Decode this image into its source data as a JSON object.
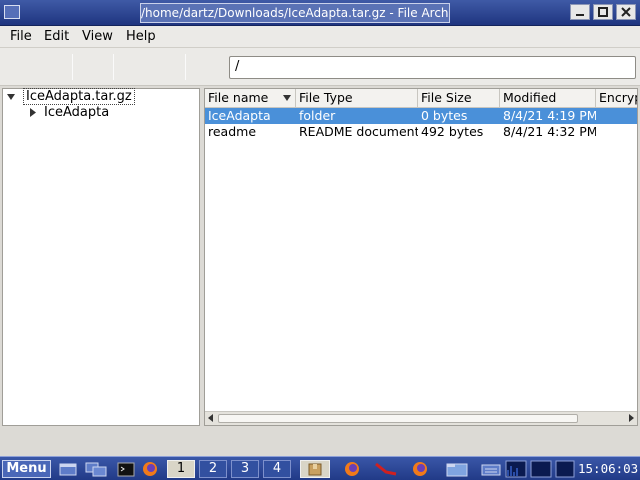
{
  "window": {
    "title": "/home/dartz/Downloads/IceAdapta.tar.gz - File Archiver"
  },
  "menubar": {
    "items": [
      "File",
      "Edit",
      "View",
      "Help"
    ]
  },
  "toolbar": {
    "location_value": "/"
  },
  "tree": {
    "root_label": "IceAdapta.tar.gz",
    "child_label": "IceAdapta"
  },
  "list": {
    "columns": [
      "File name",
      "File Type",
      "File Size",
      "Modified",
      "Encryp"
    ],
    "rows": [
      {
        "name": "IceAdapta",
        "type": "folder",
        "size": "0 bytes",
        "modified": "8/4/21 4:19 PM",
        "selected": true
      },
      {
        "name": "readme",
        "type": "README document",
        "size": "492 bytes",
        "modified": "8/4/21 4:32 PM",
        "selected": false
      }
    ]
  },
  "taskbar": {
    "menu_label": "Menu",
    "workspaces": [
      "1",
      "2",
      "3",
      "4"
    ],
    "active_workspace": "1",
    "clock": "15:06:03"
  },
  "colors": {
    "selection": "#4a90d9",
    "titlebar": "#2b4590",
    "taskbar": "#2e4a9a"
  }
}
